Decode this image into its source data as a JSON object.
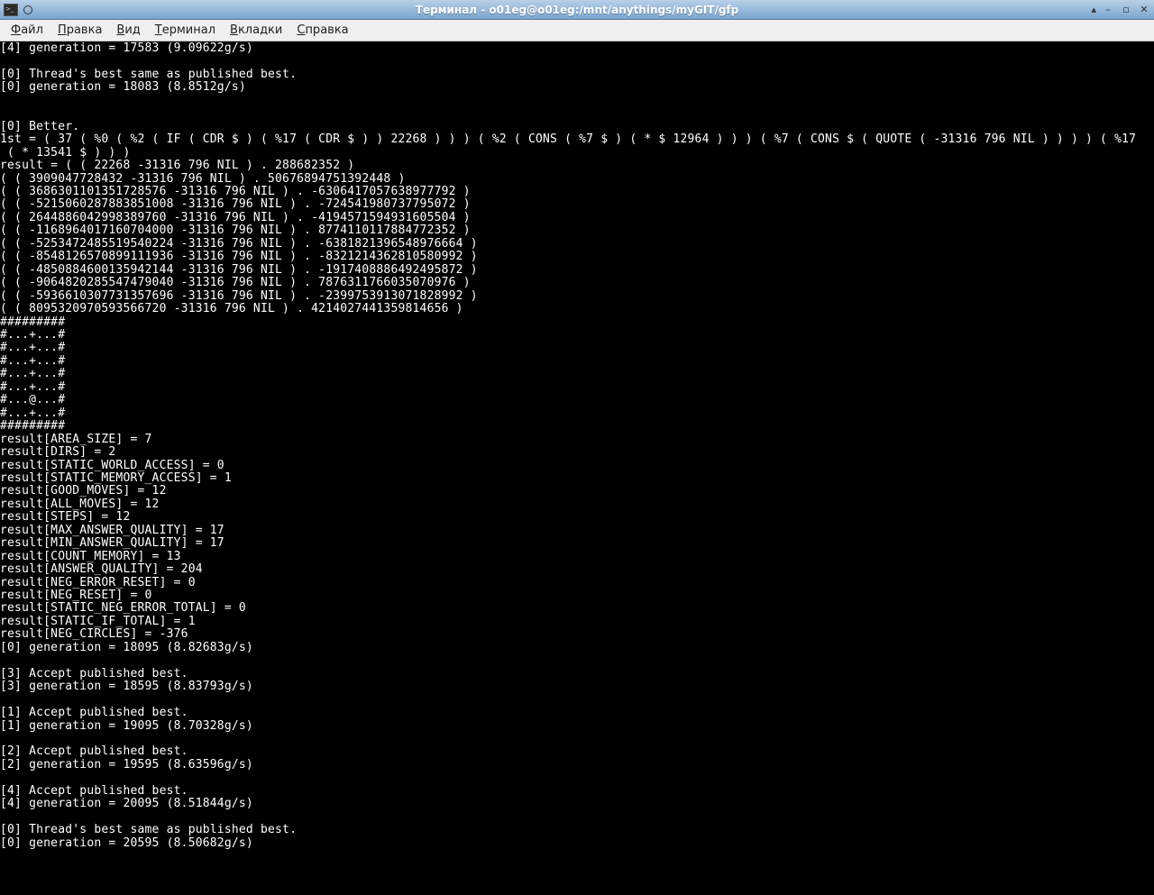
{
  "titlebar": {
    "title": "Терминал - o01eg@o01eg:/mnt/anythings/myGIT/gfp"
  },
  "menubar": {
    "file": {
      "accel": "Ф",
      "rest": "айл"
    },
    "edit": {
      "accel": "П",
      "rest": "равка"
    },
    "view": {
      "accel": "В",
      "rest": "ид"
    },
    "terminal": {
      "accel": "Т",
      "rest": "ерминал"
    },
    "tabs": {
      "accel": "В",
      "rest": "кладки"
    },
    "help": {
      "accel": "С",
      "rest": "правка"
    }
  },
  "terminal": {
    "lines": [
      "[4] generation = 17583 (9.09622g/s)",
      "",
      "[0] Thread's best same as published best.",
      "[0] generation = 18083 (8.8512g/s)",
      "",
      "",
      "[0] Better.",
      "1st = ( 37 ( %0 ( %2 ( IF ( CDR $ ) ( %17 ( CDR $ ) ) 22268 ) ) ) ( %2 ( CONS ( %7 $ ) ( * $ 12964 ) ) ) ( %7 ( CONS $ ( QUOTE ( -31316 796 NIL ) ) ) ) ( %17",
      " ( * 13541 $ ) ) )",
      "result = ( ( 22268 -31316 796 NIL ) . 288682352 )",
      "( ( 3909047728432 -31316 796 NIL ) . 50676894751392448 )",
      "( ( 3686301101351728576 -31316 796 NIL ) . -6306417057638977792 )",
      "( ( -5215060287883851008 -31316 796 NIL ) . -724541980737795072 )",
      "( ( 2644886042998389760 -31316 796 NIL ) . -4194571594931605504 )",
      "( ( -1168964017160704000 -31316 796 NIL ) . 8774110117884772352 )",
      "( ( -5253472485519540224 -31316 796 NIL ) . -6381821396548976664 )",
      "( ( -8548126570899111936 -31316 796 NIL ) . -8321214362810580992 )",
      "( ( -4850884600135942144 -31316 796 NIL ) . -1917408886492495872 )",
      "( ( -9064820285547479040 -31316 796 NIL ) . 7876311766035070976 )",
      "( ( -5936610307731357696 -31316 796 NIL ) . -2399753913071828992 )",
      "( ( 8095320970593566720 -31316 796 NIL ) . 4214027441359814656 )",
      "#########",
      "#...+...#",
      "#...+...#",
      "#...+...#",
      "#...+...#",
      "#...+...#",
      "#...@...#",
      "#...+...#",
      "#########",
      "result[AREA_SIZE] = 7",
      "result[DIRS] = 2",
      "result[STATIC_WORLD_ACCESS] = 0",
      "result[STATIC_MEMORY_ACCESS] = 1",
      "result[GOOD_MOVES] = 12",
      "result[ALL_MOVES] = 12",
      "result[STEPS] = 12",
      "result[MAX_ANSWER_QUALITY] = 17",
      "result[MIN_ANSWER_QUALITY] = 17",
      "result[COUNT_MEMORY] = 13",
      "result[ANSWER_QUALITY] = 204",
      "result[NEG_ERROR_RESET] = 0",
      "result[NEG_RESET] = 0",
      "result[STATIC_NEG_ERROR_TOTAL] = 0",
      "result[STATIC_IF_TOTAL] = 1",
      "result[NEG_CIRCLES] = -376",
      "[0] generation = 18095 (8.82683g/s)",
      "",
      "[3] Accept published best.",
      "[3] generation = 18595 (8.83793g/s)",
      "",
      "[1] Accept published best.",
      "[1] generation = 19095 (8.70328g/s)",
      "",
      "[2] Accept published best.",
      "[2] generation = 19595 (8.63596g/s)",
      "",
      "[4] Accept published best.",
      "[4] generation = 20095 (8.51844g/s)",
      "",
      "[0] Thread's best same as published best.",
      "[0] generation = 20595 (8.50682g/s)"
    ]
  }
}
